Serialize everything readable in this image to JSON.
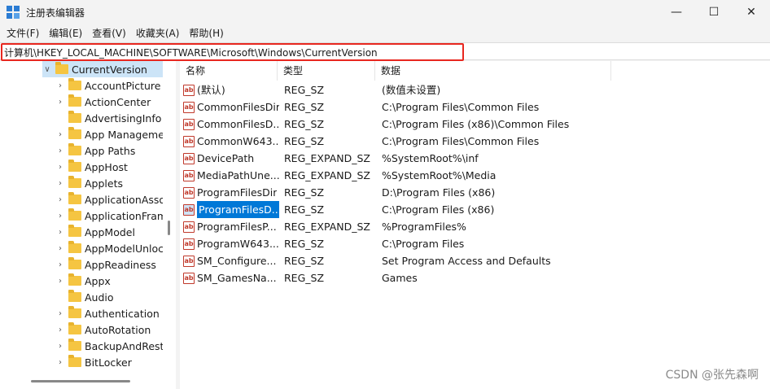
{
  "window": {
    "title": "注册表编辑器",
    "controls": {
      "minimize": "—",
      "maximize": "☐",
      "close": "✕"
    }
  },
  "menu": [
    "文件(F)",
    "编辑(E)",
    "查看(V)",
    "收藏夹(A)",
    "帮助(H)"
  ],
  "address": {
    "path": "计算机\\HKEY_LOCAL_MACHINE\\SOFTWARE\\Microsoft\\Windows\\CurrentVersion",
    "highlight_color": "#e8271f"
  },
  "tree": {
    "expanded": {
      "label": "CurrentVersion",
      "chevron": "∨"
    },
    "children": [
      "AccountPicture",
      "ActionCenter",
      "AdvertisingInfo",
      "App Managemen",
      "App Paths",
      "AppHost",
      "Applets",
      "ApplicationAssoc",
      "ApplicationFrame",
      "AppModel",
      "AppModelUnloc",
      "AppReadiness",
      "Appx",
      "Audio",
      "Authentication",
      "AutoRotation",
      "BackupAndResto",
      "BitLocker"
    ],
    "expandable": [
      true,
      true,
      false,
      true,
      true,
      true,
      true,
      true,
      true,
      true,
      true,
      true,
      true,
      false,
      true,
      true,
      true,
      true
    ]
  },
  "list": {
    "columns": [
      "名称",
      "类型",
      "数据"
    ],
    "rows": [
      {
        "name": "(默认)",
        "type": "REG_SZ",
        "data": "(数值未设置)"
      },
      {
        "name": "CommonFilesDir",
        "type": "REG_SZ",
        "data": "C:\\Program Files\\Common Files"
      },
      {
        "name": "CommonFilesD...",
        "type": "REG_SZ",
        "data": "C:\\Program Files (x86)\\Common Files"
      },
      {
        "name": "CommonW643...",
        "type": "REG_SZ",
        "data": "C:\\Program Files\\Common Files"
      },
      {
        "name": "DevicePath",
        "type": "REG_EXPAND_SZ",
        "data": "%SystemRoot%\\inf"
      },
      {
        "name": "MediaPathUne...",
        "type": "REG_EXPAND_SZ",
        "data": "%SystemRoot%\\Media"
      },
      {
        "name": "ProgramFilesDir",
        "type": "REG_SZ",
        "data": "D:\\Program Files (x86)"
      },
      {
        "name": "ProgramFilesD...",
        "type": "REG_SZ",
        "data": "C:\\Program Files (x86)",
        "selected": true
      },
      {
        "name": "ProgramFilesP...",
        "type": "REG_EXPAND_SZ",
        "data": "%ProgramFiles%"
      },
      {
        "name": "ProgramW643...",
        "type": "REG_SZ",
        "data": "C:\\Program Files"
      },
      {
        "name": "SM_Configure...",
        "type": "REG_SZ",
        "data": "Set Program Access and Defaults"
      },
      {
        "name": "SM_GamesNa...",
        "type": "REG_SZ",
        "data": "Games"
      }
    ],
    "value_icon": "ab"
  },
  "watermark": "CSDN @张先森啊"
}
